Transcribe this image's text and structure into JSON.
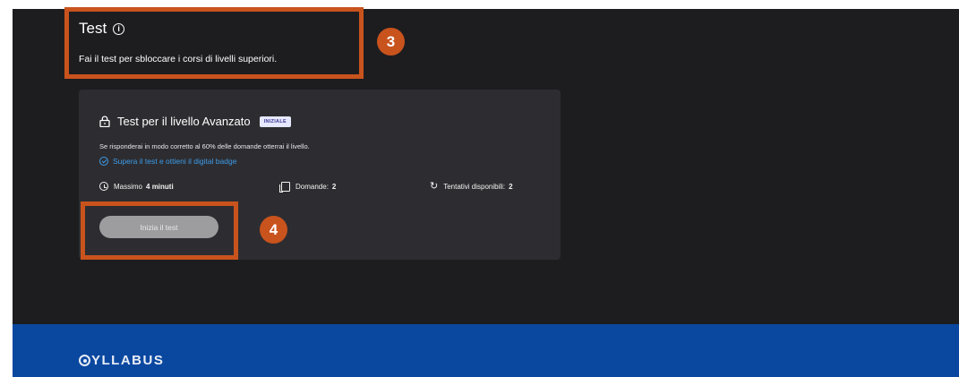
{
  "section": {
    "title": "Test",
    "subtitle": "Fai il test per sbloccare i corsi di livelli superiori."
  },
  "card": {
    "title": "Test per il livello Avanzato",
    "badge": "INIZIALE",
    "description": "Se risponderai in modo corretto al 60% delle domande otterrai il livello.",
    "badge_link": "Supera il test e ottieni il digital badge",
    "max_time_label": "Massimo",
    "max_time_value": "4 minuti",
    "questions_label": "Domande:",
    "questions_value": "2",
    "attempts_label": "Tentativi disponibili:",
    "attempts_value": "2",
    "start_button": "Inizia il test"
  },
  "annotations": {
    "step_3": "3",
    "step_4": "4"
  },
  "footer": {
    "logo_text": "YLLABUS"
  },
  "colors": {
    "background": "#1d1d20",
    "card": "#2d2d31",
    "footer": "#0a48a0",
    "annotation": "#c9531d",
    "link": "#3d9be8"
  },
  "icons": [
    "info-icon",
    "lock-icon",
    "check-circle-icon",
    "clock-icon",
    "questions-icon",
    "retry-icon",
    "syllabus-logo-icon"
  ]
}
